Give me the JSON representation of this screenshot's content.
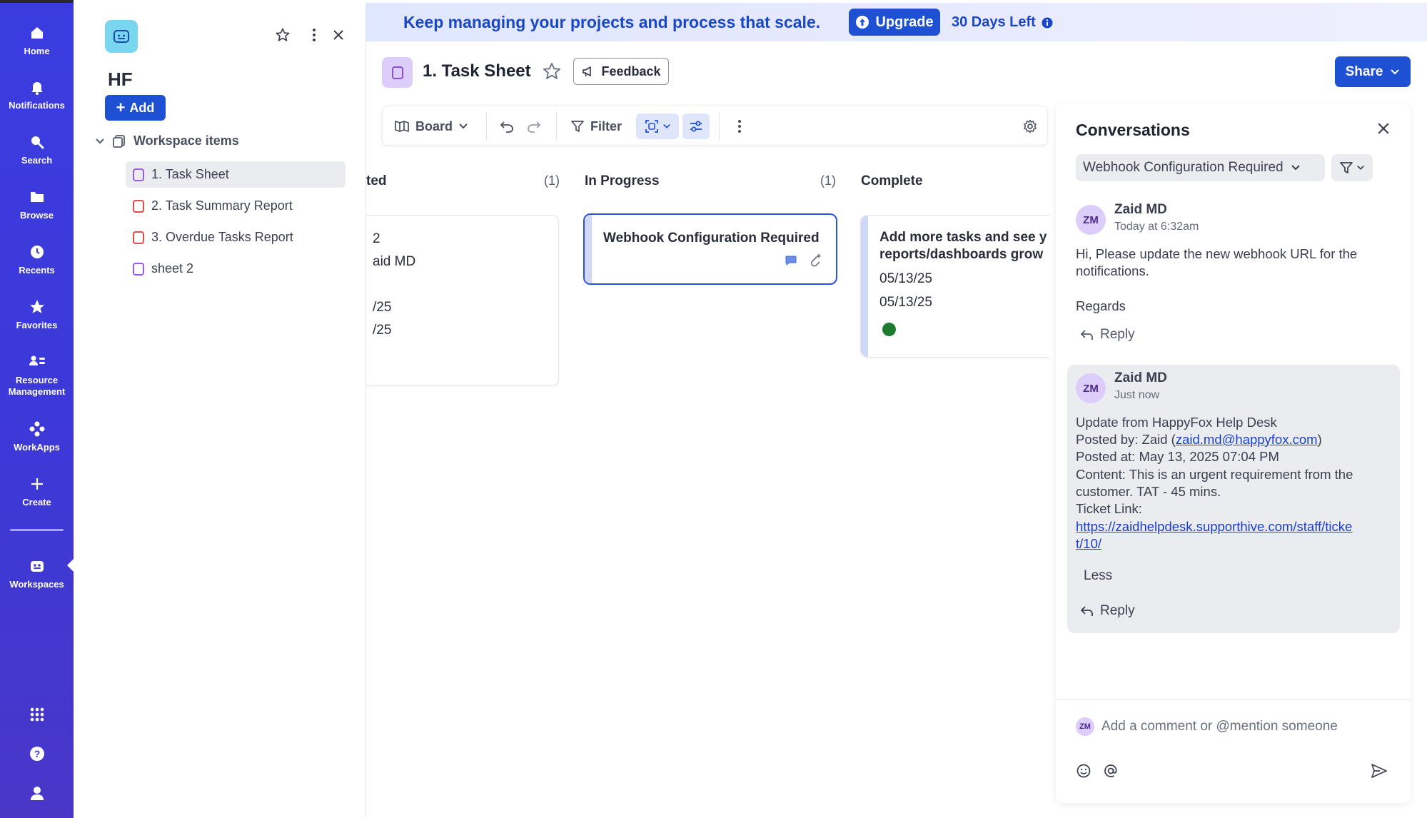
{
  "nav": {
    "items": [
      {
        "label": "Home",
        "icon": "home-icon"
      },
      {
        "label": "Notifications",
        "icon": "bell-icon"
      },
      {
        "label": "Search",
        "icon": "search-icon"
      },
      {
        "label": "Browse",
        "icon": "folder-icon"
      },
      {
        "label": "Recents",
        "icon": "clock-icon"
      },
      {
        "label": "Favorites",
        "icon": "star-icon"
      },
      {
        "label_line1": "Resource",
        "label_line2": "Management",
        "icon": "people-icon"
      },
      {
        "label": "WorkApps",
        "icon": "workapps-icon"
      },
      {
        "label": "Create",
        "icon": "plus-icon"
      },
      {
        "label": "Workspaces",
        "icon": "workspace-icon"
      }
    ]
  },
  "workspace": {
    "title": "HF",
    "add_label": "Add",
    "section_label": "Workspace items",
    "items": [
      {
        "label": "1. Task Sheet",
        "type": "sheet",
        "active": true
      },
      {
        "label": "2. Task Summary Report",
        "type": "report"
      },
      {
        "label": "3. Overdue Tasks Report",
        "type": "report"
      },
      {
        "label": "sheet 2",
        "type": "sheet"
      }
    ]
  },
  "banner": {
    "text": "Keep managing your projects and process that scale.",
    "upgrade_label": "Upgrade",
    "days_left": "30 Days Left"
  },
  "header": {
    "title": "1. Task Sheet",
    "feedback_label": "Feedback",
    "share_label": "Share"
  },
  "toolbar": {
    "view_label": "Board",
    "filter_label": "Filter"
  },
  "board": {
    "columns": [
      {
        "title": "ted",
        "count": "(1)",
        "card_lines": [
          "2",
          "aid MD",
          "/25",
          "/25"
        ]
      },
      {
        "title": "In Progress",
        "count": "(1)",
        "card_title": "Webhook Configuration Required"
      },
      {
        "title": "Complete",
        "card_title_line1": "Add more tasks and see y",
        "card_title_line2": "reports/dashboards grow",
        "date1": "05/13/25",
        "date2": "05/13/25",
        "status_color": "#1e7a30"
      }
    ]
  },
  "conversations": {
    "title": "Conversations",
    "filter_value": "Webhook Configuration Required",
    "messages": [
      {
        "initials": "ZM",
        "author": "Zaid MD",
        "time": "Today at 6:32am",
        "lines": [
          "Hi, Please update the new webhook URL for the",
          "notifications.",
          "Regards"
        ],
        "reply_label": "Reply"
      },
      {
        "initials": "ZM",
        "author": "Zaid MD",
        "time": "Just now",
        "line1": "Update from HappyFox Help Desk",
        "posted_by_prefix": "Posted by: Zaid (",
        "posted_by_email": "zaid.md@happyfox.com",
        "posted_by_suffix": ")",
        "posted_at": "Posted at: May 13, 2025 07:04 PM",
        "content_line1": "Content: This is an urgent requirement from the",
        "content_line2": "customer. TAT - 45 mins.",
        "ticket_label": "Ticket Link:",
        "ticket_url_line1": "https://zaidhelpdesk.supporthive.com/staff/ticke",
        "ticket_url_line2": "t/10/",
        "less_label": "Less",
        "reply_label": "Reply"
      }
    ],
    "composer": {
      "initials": "ZM",
      "placeholder": "Add a comment or @mention someone"
    }
  },
  "colors": {
    "rail": "#3b3ce0",
    "primary": "#1d50d3",
    "banner_text": "#1a46c8"
  }
}
